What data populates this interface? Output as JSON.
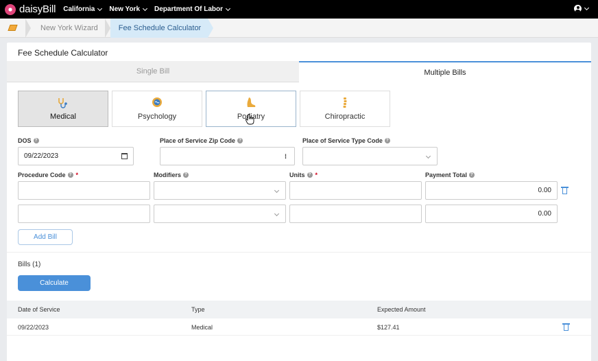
{
  "nav": {
    "brand": "daisyBill",
    "items": [
      "California",
      "New York",
      "Department Of Labor"
    ]
  },
  "breadcrumb": {
    "items": [
      "New York Wizard"
    ],
    "active": "Fee Schedule Calculator"
  },
  "page": {
    "title": "Fee Schedule Calculator",
    "tabs": [
      {
        "label": "Single Bill",
        "active": false
      },
      {
        "label": "Multiple Bills",
        "active": true
      }
    ],
    "categories": [
      {
        "label": "Medical",
        "icon": "stethoscope-icon",
        "selected": true
      },
      {
        "label": "Psychology",
        "icon": "brain-icon",
        "selected": false
      },
      {
        "label": "Podiatry",
        "icon": "foot-icon",
        "selected": false
      },
      {
        "label": "Chiropractic",
        "icon": "spine-icon",
        "selected": false
      }
    ]
  },
  "form": {
    "dos_label": "DOS",
    "dos_value": "09/22/2023",
    "zip_label": "Place of Service Zip Code",
    "zip_value": "",
    "type_label": "Place of Service Type Code",
    "type_value": "",
    "procedure_label": "Procedure Code",
    "modifiers_label": "Modifiers",
    "units_label": "Units",
    "payment_label": "Payment Total",
    "required_mark": "*",
    "rows": [
      {
        "procedure": "",
        "modifiers": "",
        "units": "",
        "payment": "0.00"
      },
      {
        "procedure": "",
        "modifiers": "",
        "units": "",
        "payment": "0.00"
      }
    ],
    "add_bill_label": "Add Bill"
  },
  "bills": {
    "title": "Bills (1)",
    "calculate_label": "Calculate",
    "columns": [
      "Date of Service",
      "Type",
      "Expected Amount"
    ],
    "rows": [
      {
        "date": "09/22/2023",
        "type": "Medical",
        "amount": "$127.41"
      }
    ]
  },
  "colors": {
    "accent": "#4a90d9",
    "brand_pink": "#e0457b",
    "required": "#d0021b"
  }
}
